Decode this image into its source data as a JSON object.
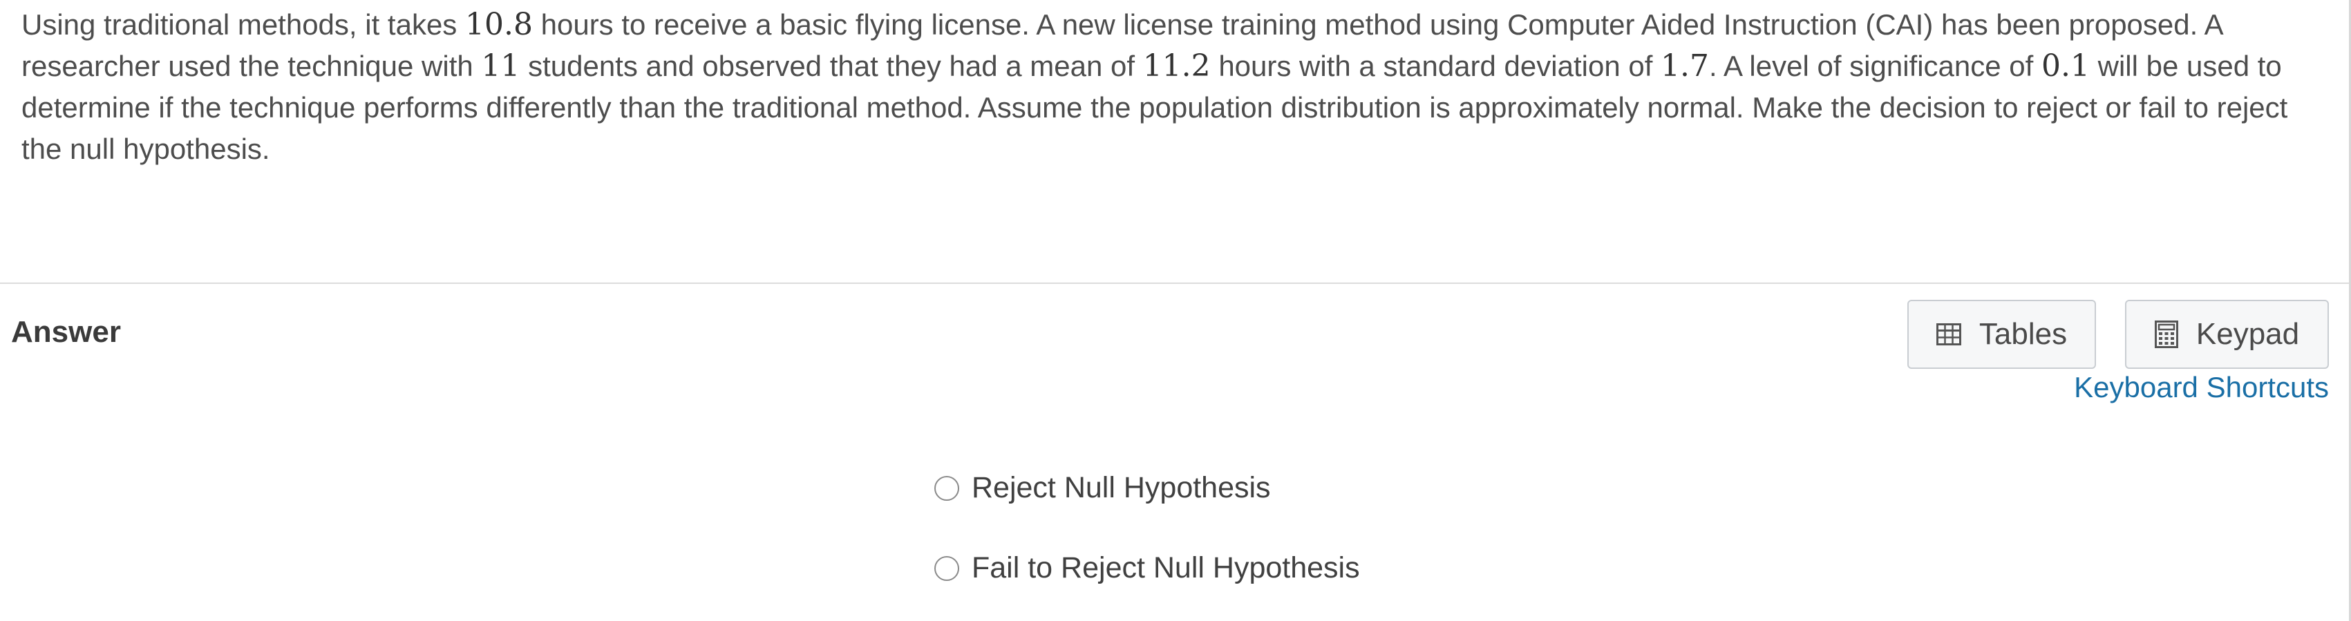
{
  "question": {
    "p1": "Using traditional methods, it takes ",
    "n1": "10.8",
    "p2": " hours to receive a basic flying license.  A new license training method using Computer Aided Instruction (CAI) has been proposed.  A researcher used the technique with ",
    "n2": "11",
    "p3": " students and observed that they had a mean of ",
    "n3": "11.2",
    "p4": " hours with a standard deviation of ",
    "n4": "1.7",
    "p5": ".  A level of significance of ",
    "n5": "0.1",
    "p6": " will be used to determine if the technique performs differently than the traditional method.  Assume the population distribution is approximately normal.  Make the decision to reject or fail to reject the null hypothesis."
  },
  "answer": {
    "label": "Answer",
    "tables_label": "Tables",
    "keypad_label": "Keypad",
    "shortcuts_label": "Keyboard Shortcuts",
    "options": [
      {
        "label": "Reject Null Hypothesis",
        "selected": false
      },
      {
        "label": "Fail to Reject Null Hypothesis",
        "selected": false
      }
    ]
  },
  "icons": {
    "tables": "table-grid-icon",
    "keypad": "calculator-icon"
  },
  "colors": {
    "link": "#1a6fa6",
    "divider": "#dcdcdc",
    "button_border": "#c9cdd2"
  }
}
